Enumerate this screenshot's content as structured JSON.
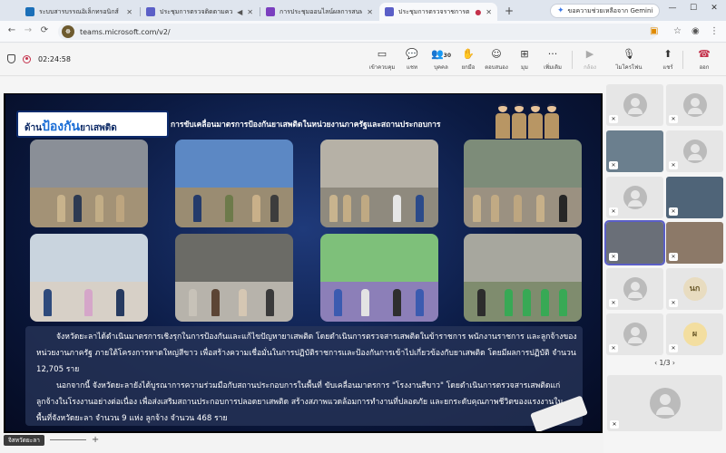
{
  "browser": {
    "tabs": [
      {
        "title": "ระบบสารบรรณอิเล็กทรอนิกส์",
        "favicon_color": "#1b6fb8",
        "active": false
      },
      {
        "title": "ประชุมการตรวจติดตามความก้าวหน้า",
        "favicon_color": "#5b5fc7",
        "active": false
      },
      {
        "title": "การประชุมออนไลน์ผลการสนทนาฯ",
        "favicon_color": "#7b3fbf",
        "active": false
      },
      {
        "title": "ประชุมการตรวจราชการตามแผนฯ",
        "favicon_color": "#5b5fc7",
        "active": true
      }
    ],
    "new_tab_label": "+",
    "gemini_label": "ขอความช่วยเหลือจาก Gemini",
    "url": "teams.microsoft.com/v2/"
  },
  "meeting": {
    "timer": "02:24:58",
    "toolbar": {
      "presenter_label": "เข้าควบคุม",
      "chat_label": "แชท",
      "people_label": "บุคคล",
      "people_count": "30",
      "raise_label": "ยกมือ",
      "react_label": "ตอบสนอง",
      "view_label": "มุม",
      "more_label": "เพิ่มเติม",
      "camera_label": "กล้อง",
      "mic_label": "ไมโครโฟน",
      "share_label": "แชร์",
      "leave_label": "ออก"
    },
    "presenter_name": "จิสหวัดยะลา",
    "pager": "1/3"
  },
  "slide": {
    "title_a": "ด้าน",
    "title_b": "ป้องกัน",
    "title_c": "ยาเสพติด",
    "subtitle": "การขับเคลื่อนมาตรการป้องกันยาเสพติดในหน่วยงานภาครัฐและสถานประกอบการ",
    "paragraph1": "จังหวัดยะลาได้ดำเนินมาตรการเชิงรุกในการป้องกันและแก้ไขปัญหายาเสพติด โดยดำเนินการตรวจสารเสพติดในข้าราชการ พนักงานราชการ และลูกจ้างของหน่วยงานภาครัฐ ภายใต้โครงการหาดใหญ่สีขาว เพื่อสร้างความเชื่อมั่นในการปฏิบัติราชการและป้องกันการเข้าไปเกี่ยวข้องกับยาเสพติด โดยมีผลการปฏิบัติ จำนวน 12,705 ราย",
    "paragraph2": "นอกจากนี้ จังหวัดยะลายังได้บูรณาการความร่วมมือกับสถานประกอบการในพื้นที่ ขับเคลื่อนมาตรการ \"โรงงานสีขาว\" โดยดำเนินการตรวจสารเสพติดแก่ลูกจ้างในโรงงานอย่างต่อเนื่อง เพื่อส่งเสริมสถานประกอบการปลอดยาเสพติด สร้างสภาพแวดล้อมการทำงานที่ปลอดภัย และยกระดับคุณภาพชีวิตของแรงงานในพื้นที่จังหวัดยะลา จำนวน 9 แห่ง ลูกจ้าง จำนวน 468 ราย"
  },
  "participants": {
    "initials": [
      "นก",
      "ผ"
    ],
    "initial_colors": [
      "#e8dcc0",
      "#f3dea0"
    ],
    "accent": "#5b5fc7",
    "leave_color": "#c4314b"
  }
}
